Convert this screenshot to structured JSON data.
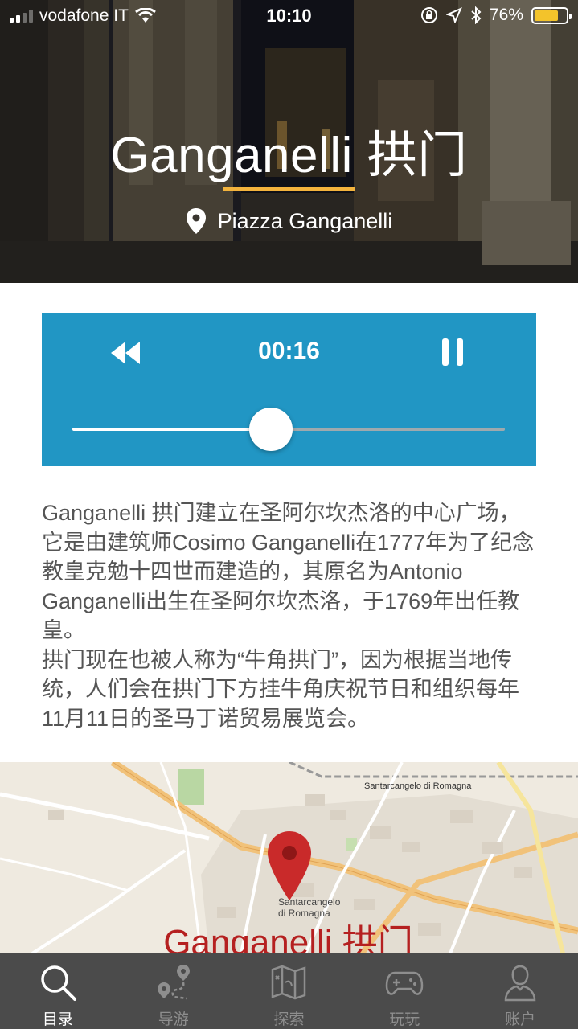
{
  "status_bar": {
    "carrier": "vodafone IT",
    "time": "10:10",
    "battery_percent": "76%",
    "battery_level": 0.76,
    "signal_bars": 2,
    "icons": [
      "wifi-icon",
      "rotation-lock-icon",
      "location-arrow-icon",
      "bluetooth-icon",
      "battery-icon"
    ]
  },
  "hero": {
    "title": "Ganganelli 拱门",
    "location": "Piazza Ganganelli",
    "accent_color": "#f3b33d"
  },
  "player": {
    "current_time": "00:16",
    "progress": 0.46,
    "background_color": "#2196c4"
  },
  "description": {
    "paragraphs": [
      "Ganganelli 拱门建立在圣阿尔坎杰洛的中心广场，它是由建筑师Cosimo Ganganelli在1777年为了纪念教皇克勉十四世而建造的，其原名为Antonio Ganganelli出生在圣阿尔坎杰洛，于1769年出任教皇。",
      "拱门现在也被人称为“牛角拱门”，因为根据当地传统，人们会在拱门下方挂牛角庆祝节日和组织每年11月11日的圣马丁诺贸易展览会。"
    ]
  },
  "map": {
    "place_label": "Ganganelli 拱门",
    "town_label": "Santarcangelo di Romagna",
    "town_label_line1": "Santarcangelo",
    "town_label_line2": "di Romagna",
    "top_label": "Santarcangelo di Romagna",
    "pin_color": "#c92a2a"
  },
  "tabbar": {
    "items": [
      {
        "label": "目录",
        "icon": "search-icon",
        "active": true
      },
      {
        "label": "导游",
        "icon": "route-icon",
        "active": false
      },
      {
        "label": "探索",
        "icon": "map-icon",
        "active": false
      },
      {
        "label": "玩玩",
        "icon": "gamepad-icon",
        "active": false
      },
      {
        "label": "账户",
        "icon": "user-icon",
        "active": false
      }
    ]
  }
}
